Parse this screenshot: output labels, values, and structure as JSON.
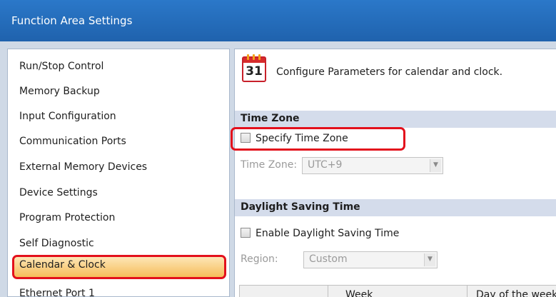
{
  "window": {
    "title": "Function Area Settings"
  },
  "sidebar": {
    "items": [
      {
        "label": "Run/Stop Control"
      },
      {
        "label": "Memory Backup"
      },
      {
        "label": "Input Configuration"
      },
      {
        "label": "Communication Ports"
      },
      {
        "label": "External Memory Devices"
      },
      {
        "label": "Device Settings"
      },
      {
        "label": "Program Protection"
      },
      {
        "label": "Self Diagnostic"
      },
      {
        "label": "Calendar & Clock"
      },
      {
        "label": "Ethernet Port 1"
      }
    ],
    "selected": "Calendar & Clock"
  },
  "content": {
    "icon": {
      "name": "calendar-icon",
      "number": "31"
    },
    "intro": "Configure Parameters for calendar and clock.",
    "time_zone": {
      "header": "Time Zone",
      "specify_label": "Specify Time Zone",
      "specify_checked": false,
      "zone_label": "Time Zone:",
      "zone_value": "UTC+9"
    },
    "dst": {
      "header": "Daylight Saving Time",
      "enable_label": "Enable Daylight Saving Time",
      "enable_checked": false,
      "region_label": "Region:",
      "region_value": "Custom"
    },
    "grid": {
      "columns": [
        "",
        "Week",
        "Day of the week"
      ]
    }
  },
  "colors": {
    "title_bar": "#1f62ad",
    "highlight": "#e3101c",
    "selected_bg": "#f6bd5a",
    "section_bg": "#d4dceb"
  }
}
